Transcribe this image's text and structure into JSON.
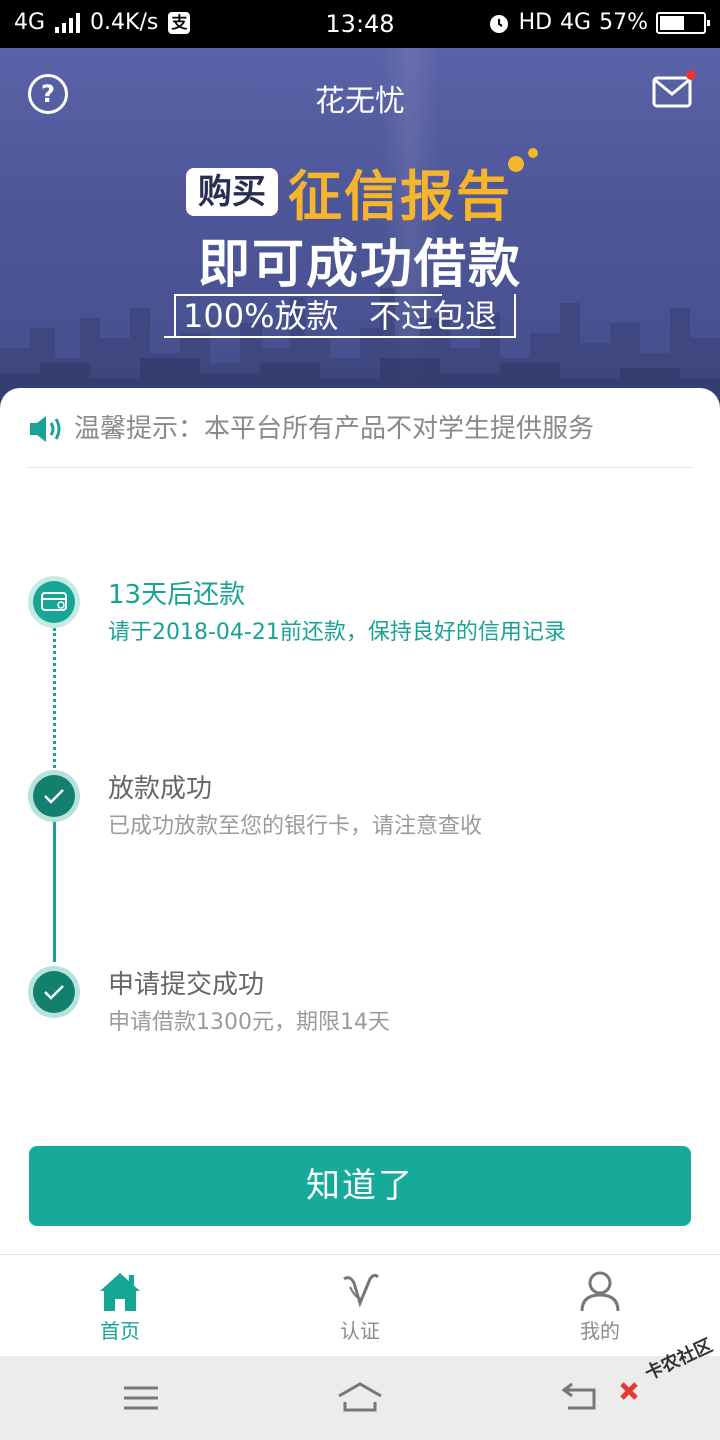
{
  "status_bar": {
    "network": "4G",
    "speed": "0.4K/s",
    "pay_badge": "支",
    "time": "13:48",
    "hd": "HD",
    "network_right": "4G",
    "battery": "57%",
    "battery_level": 0.57
  },
  "header": {
    "title": "花无忧"
  },
  "banner": {
    "buy_label": "购买",
    "credit_label": "征信报告",
    "headline": "即可成功借款",
    "tagline": "100%放款   不过包退",
    "accent_color": "#f7b52b"
  },
  "notice": {
    "text": "温馨提示：本平台所有产品不对学生提供服务"
  },
  "timeline": [
    {
      "title": "13天后还款",
      "desc": "请于2018-04-21前还款，保持良好的信用记录",
      "state": "active",
      "icon": "card-icon"
    },
    {
      "title": "放款成功",
      "desc": "已成功放款至您的银行卡，请注意查收",
      "state": "done",
      "icon": "check-icon"
    },
    {
      "title": "申请提交成功",
      "desc": "申请借款1300元，期限14天",
      "state": "done",
      "icon": "check-icon"
    }
  ],
  "actions": {
    "confirm_label": "知道了"
  },
  "tabs": [
    {
      "label": "首页",
      "icon": "home-icon",
      "active": true
    },
    {
      "label": "认证",
      "icon": "verify-icon",
      "active": false
    },
    {
      "label": "我的",
      "icon": "profile-icon",
      "active": false
    }
  ],
  "watermark": {
    "text": "卡农社区"
  },
  "colors": {
    "primary": "#17a596",
    "banner": "#4d5698"
  }
}
